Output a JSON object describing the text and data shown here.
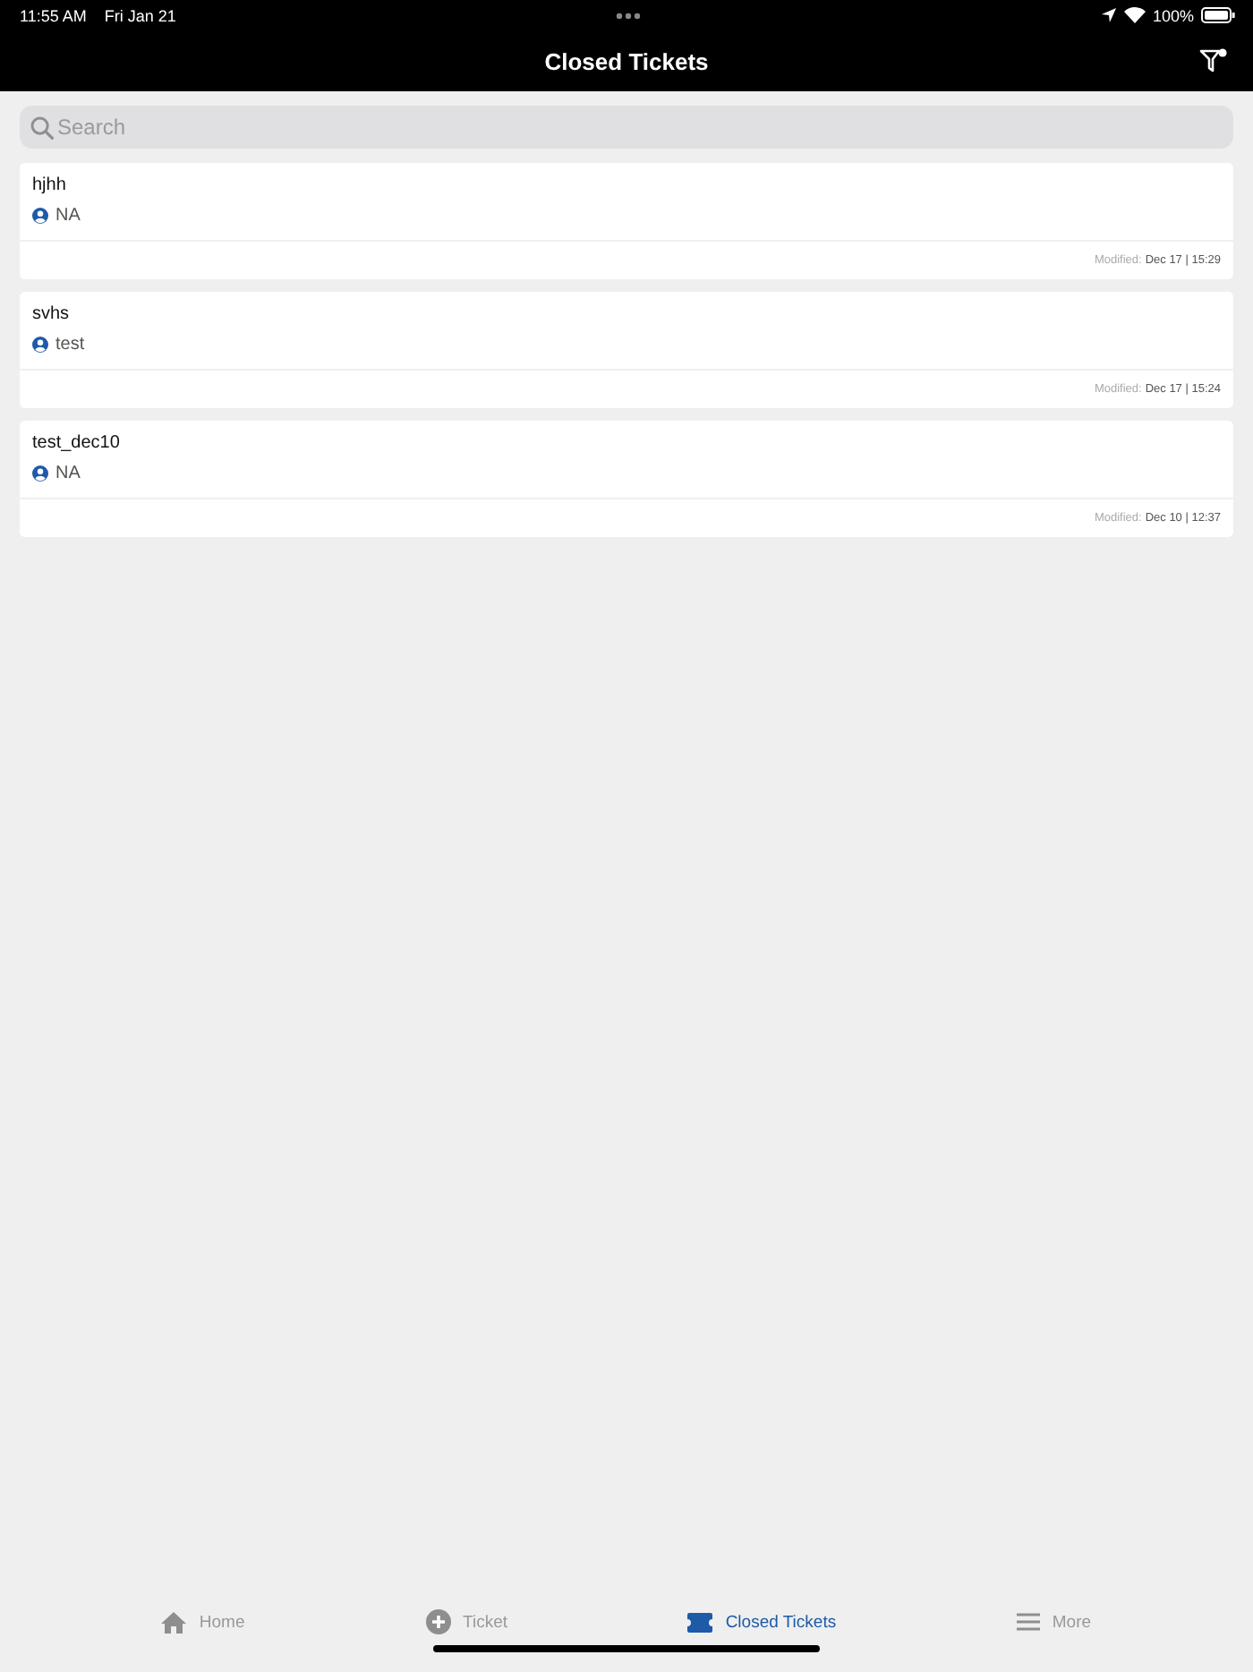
{
  "status_bar": {
    "time": "11:55 AM",
    "date": "Fri Jan 21",
    "battery": "100%"
  },
  "nav_bar": {
    "title": "Closed Tickets"
  },
  "search": {
    "placeholder": "Search"
  },
  "tickets": [
    {
      "title": "hjhh",
      "assignee": "NA",
      "modified_label": "Modified:",
      "modified": "Dec 17 | 15:29"
    },
    {
      "title": "svhs",
      "assignee": "test",
      "modified_label": "Modified:",
      "modified": "Dec 17 | 15:24"
    },
    {
      "title": "test_dec10",
      "assignee": "NA",
      "modified_label": "Modified:",
      "modified": "Dec 10 | 12:37"
    }
  ],
  "tab_bar": [
    {
      "label": "Home",
      "kind": "home",
      "selected": false
    },
    {
      "label": "Ticket",
      "kind": "add",
      "selected": false
    },
    {
      "label": "Closed Tickets",
      "kind": "ticket",
      "selected": true
    },
    {
      "label": "More",
      "kind": "menu",
      "selected": false
    }
  ]
}
